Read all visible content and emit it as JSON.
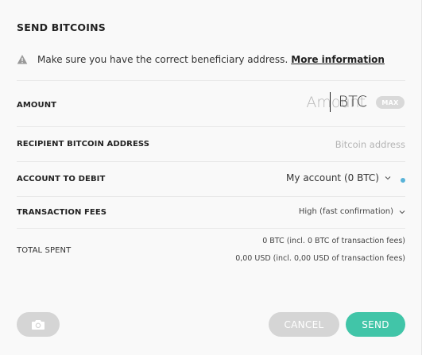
{
  "dialog": {
    "title": "SEND BITCOINS",
    "warning": {
      "text": "Make sure you have the correct beneficiary address.",
      "link": "More information",
      "icon": "warning-triangle-icon"
    }
  },
  "form": {
    "amount": {
      "label": "AMOUNT",
      "placeholder": "Amount",
      "unit": "BTC",
      "max_label": "MAX"
    },
    "recipient": {
      "label": "RECIPIENT BITCOIN ADDRESS",
      "placeholder": "Bitcoin address"
    },
    "account": {
      "label": "ACCOUNT TO DEBIT",
      "selected": "My account (0 BTC)",
      "status_color": "#59b3d8"
    },
    "fees": {
      "label": "TRANSACTION FEES",
      "selected": "High (fast confirmation)"
    },
    "total": {
      "label": "TOTAL SPENT",
      "btc_line": "0 BTC (incl. 0 BTC of transaction fees)",
      "usd_line": "0,00 USD (incl. 0,00 USD of transaction fees)"
    }
  },
  "actions": {
    "camera_icon": "camera-icon",
    "cancel_label": "CANCEL",
    "send_label": "SEND"
  },
  "colors": {
    "accent": "#41c5a8",
    "neutral_button": "#d5d5d5",
    "background": "#f9f9f9"
  }
}
